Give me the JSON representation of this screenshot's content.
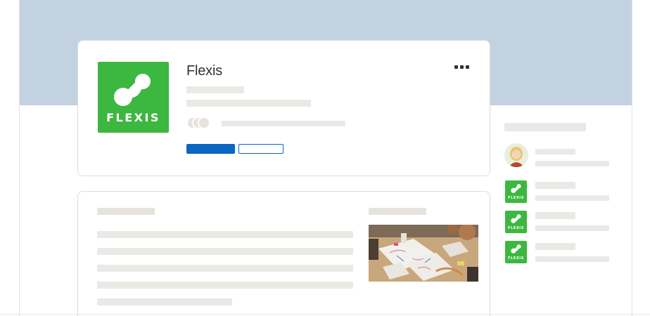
{
  "company": {
    "name": "Flexis",
    "logo_word": "FLEXIS",
    "brand_color": "#3cb73f"
  },
  "sidebar": {
    "logo_word": "FLEXIS"
  },
  "colors": {
    "banner": "#c3d2e1",
    "primary": "#0a66c2",
    "placeholder": "#ebe9e6"
  },
  "icons": {
    "more": "more-horizontal-icon",
    "logo": "flexis-logo-icon"
  }
}
